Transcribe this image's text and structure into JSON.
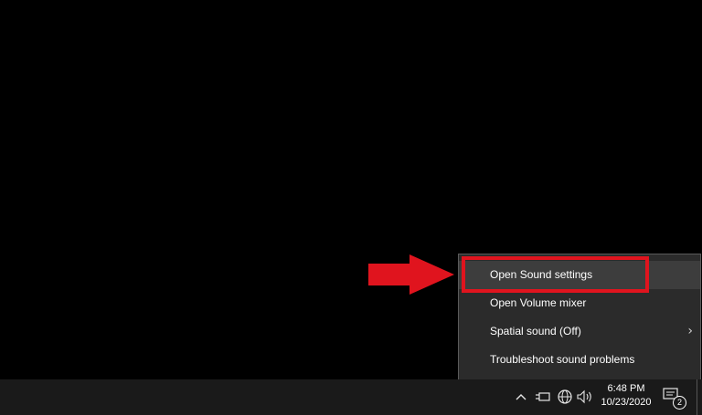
{
  "context_menu": {
    "items": [
      {
        "label": "Open Sound settings"
      },
      {
        "label": "Open Volume mixer"
      },
      {
        "label": "Spatial sound (Off)",
        "has_submenu": true
      },
      {
        "label": "Troubleshoot sound problems"
      }
    ]
  },
  "annotation": {
    "arrow_color": "#e0141e",
    "box_color": "#e0141e"
  },
  "taskbar": {
    "tray_icons": [
      "chevron-up-icon",
      "power-plug-icon",
      "globe-network-icon",
      "speaker-icon"
    ],
    "clock": {
      "time": "6:48 PM",
      "date": "10/23/2020"
    },
    "notifications": {
      "count": "2",
      "icon": "notification-center-icon"
    }
  }
}
